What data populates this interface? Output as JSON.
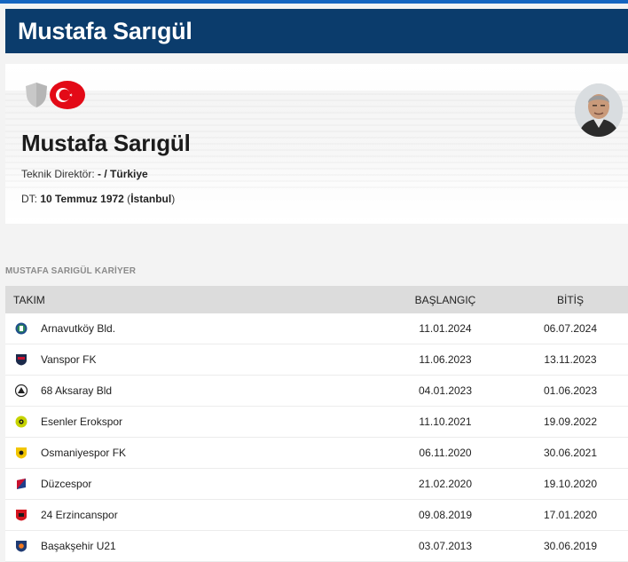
{
  "page": {
    "title": "Mustafa Sarıgül"
  },
  "profile": {
    "name": "Mustafa Sarıgül",
    "role_label": "Teknik Direktör:",
    "role_value": "- / Türkiye",
    "dob_label": "DT:",
    "dob_date": "10 Temmuz 1972",
    "dob_place_open": " (",
    "dob_place": "İstanbul",
    "dob_place_close": ")"
  },
  "career": {
    "section_title": "MUSTAFA SARIGÜL KARİYER",
    "headers": {
      "team": "TAKIM",
      "start": "BAŞLANGIÇ",
      "end": "BİTİŞ"
    },
    "rows": [
      {
        "team": "Arnavutköy Bld.",
        "start": "11.01.2024",
        "end": "06.07.2024",
        "logo_icon": "arnavutkoy-logo-icon",
        "colors": [
          "#2e8b57",
          "#1f4e8c"
        ]
      },
      {
        "team": "Vanspor FK",
        "start": "11.06.2023",
        "end": "13.11.2023",
        "logo_icon": "vanspor-logo-icon",
        "colors": [
          "#1b2a4a",
          "#c8102e"
        ]
      },
      {
        "team": "68 Aksaray Bld",
        "start": "04.01.2023",
        "end": "01.06.2023",
        "logo_icon": "aksaray-logo-icon",
        "colors": [
          "#222222",
          "#ffffff"
        ]
      },
      {
        "team": "Esenler Erokspor",
        "start": "11.10.2021",
        "end": "19.09.2022",
        "logo_icon": "esenler-logo-icon",
        "colors": [
          "#c6d300",
          "#1a1a1a"
        ]
      },
      {
        "team": "Osmaniyespor FK",
        "start": "06.11.2020",
        "end": "30.06.2021",
        "logo_icon": "osmaniye-logo-icon",
        "colors": [
          "#f2c500",
          "#1a1a1a"
        ]
      },
      {
        "team": "Düzcespor",
        "start": "21.02.2020",
        "end": "19.10.2020",
        "logo_icon": "duzcespor-logo-icon",
        "colors": [
          "#c8102e",
          "#1f3f8c"
        ]
      },
      {
        "team": "24 Erzincanspor",
        "start": "09.08.2019",
        "end": "17.01.2020",
        "logo_icon": "erzincanspor-logo-icon",
        "colors": [
          "#d4141e",
          "#1a1a1a"
        ]
      },
      {
        "team": "Başakşehir U21",
        "start": "03.07.2013",
        "end": "30.06.2019",
        "logo_icon": "basaksehir-logo-icon",
        "colors": [
          "#1f3b73",
          "#f47a20"
        ]
      }
    ]
  },
  "colors": {
    "title_bar": "#0b3c6c",
    "header_row": "#dcdcdc",
    "accent_line": "#1565c0",
    "flag_red": "#e30a17"
  }
}
